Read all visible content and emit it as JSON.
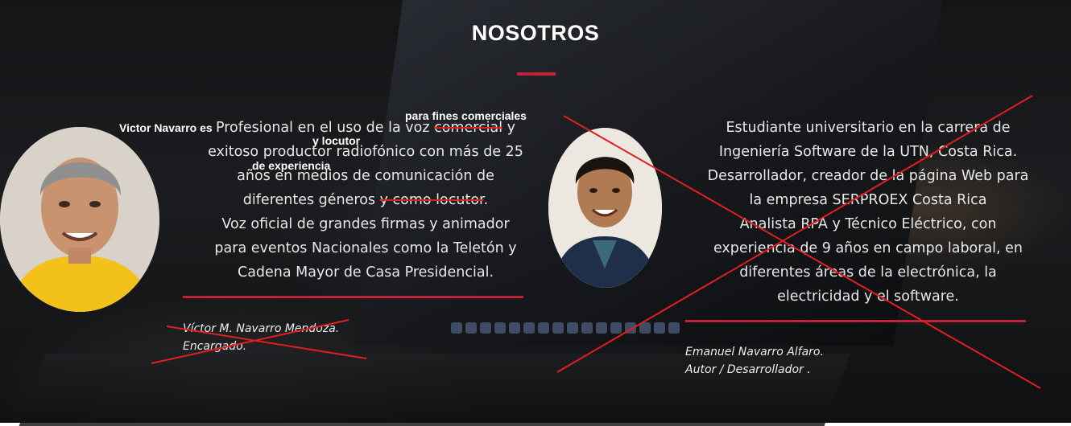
{
  "section": {
    "title": "NOSOTROS"
  },
  "left": {
    "avatar_alt": "Victor Navarro",
    "annotations": {
      "intro": "Victor Navarro es",
      "fines": "para fines comerciales",
      "locutor": "y locutor",
      "experiencia": "de experiencia"
    },
    "bio": {
      "l1_a": "Profesional en el uso de la voz ",
      "l1_strike": "comercial",
      "l1_b": " y",
      "l2": "exitoso productor radiofónico con más de 25",
      "l3": "años en medios de comunicación de",
      "l4_a": "diferentes géneros ",
      "l4_strike": "y como locutor",
      "l4_b": ".",
      "l5": "Voz oficial de grandes firmas y animador",
      "l6": "para eventos Nacionales como la Teletón y",
      "l7": "Cadena Mayor de Casa Presidencial."
    },
    "signature": {
      "name": "Víctor M. Navarro Mendoza.",
      "role": "Encargado."
    }
  },
  "right": {
    "avatar_alt": "Emanuel Navarro",
    "bio": {
      "l1": "Estudiante universitario en la carrera de",
      "l2": "Ingeniería Software de la UTN, Costa Rica.",
      "l3": "Desarrollador, creador de la página Web para",
      "l4": "la empresa SERPROEX Costa Rica",
      "l5": "Analista RPA y Técnico Eléctrico, con",
      "l6": "experiencia de 9 años en campo laboral, en",
      "l7": "diferentes áreas de la electrónica, la",
      "l8": "electricidad y el software."
    },
    "signature": {
      "name": "Emanuel Navarro Alfaro.",
      "role": "Autor / Desarrollador ."
    }
  },
  "colors": {
    "accent": "#c0223a",
    "annotation_red": "#e02020"
  }
}
